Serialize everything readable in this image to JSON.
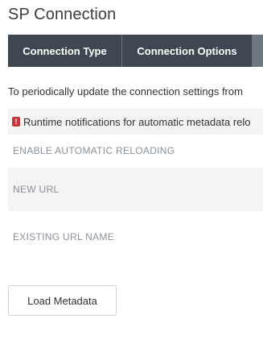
{
  "page": {
    "title": "SP Connection"
  },
  "tabs": [
    {
      "label": "Connection Type"
    },
    {
      "label": "Connection Options"
    },
    {
      "label": ""
    }
  ],
  "main": {
    "intro_text": "To periodically update the connection settings from",
    "notice": {
      "icon": "exclamation-icon",
      "text": "Runtime notifications for automatic metadata relo"
    },
    "fields": {
      "enable_label": "ENABLE AUTOMATIC RELOADING",
      "new_url_label": "NEW URL",
      "existing_url_label": "EXISTING URL NAME"
    },
    "load_button_label": "Load Metadata"
  },
  "colors": {
    "tab_background": "#3f4852",
    "notice_icon": "#c8363a",
    "label_gray": "#8a9199"
  }
}
